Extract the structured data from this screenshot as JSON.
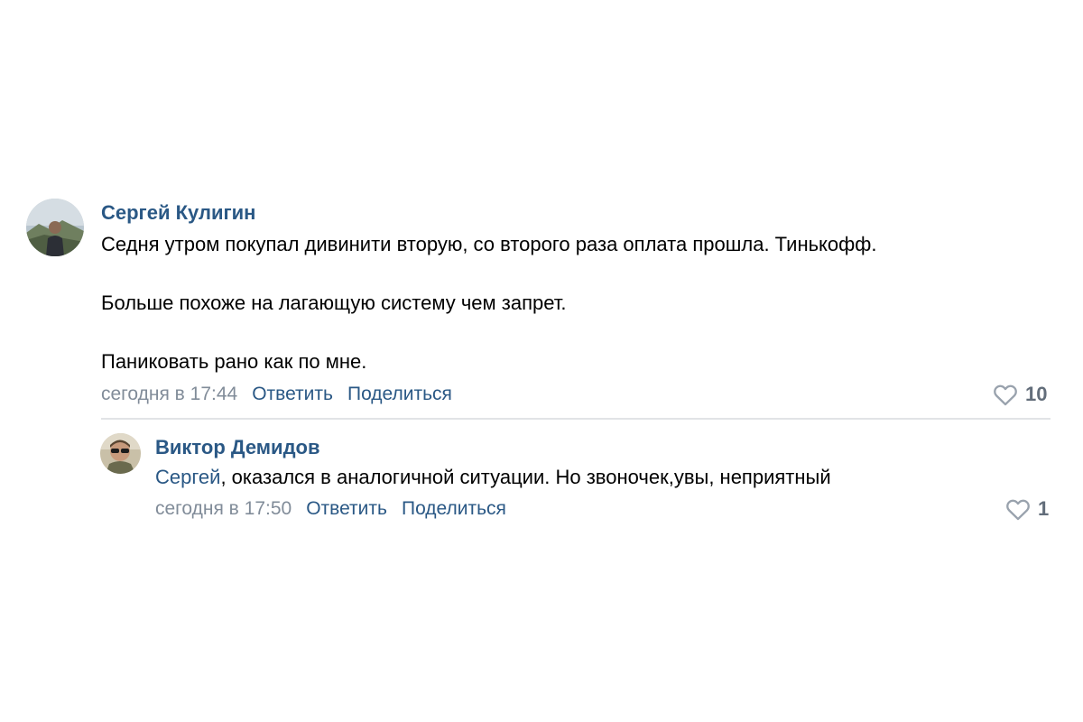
{
  "comments": [
    {
      "author": "Сергей Кулигин",
      "paragraphs": [
        "Седня утром покупал дивинити вторую, со второго раза оплата прошла. Тинькофф.",
        "Больше похоже на лагающую систему чем запрет.",
        "Паниковать рано как по мне."
      ],
      "date": "сегодня в 17:44",
      "reply_label": "Ответить",
      "share_label": "Поделиться",
      "likes": "10"
    }
  ],
  "reply": {
    "author": "Виктор Демидов",
    "mention": "Сергей",
    "text": ", оказался в аналогичной ситуации. Но звоночек,увы, неприятный",
    "date": "сегодня в 17:50",
    "reply_label": "Ответить",
    "share_label": "Поделиться",
    "likes": "1"
  },
  "colors": {
    "link": "#2a5885",
    "meta": "#818c99",
    "like_icon": "#99a2ad",
    "divider": "#e1e3e6"
  },
  "icons": {
    "like": "heart-outline-icon"
  }
}
